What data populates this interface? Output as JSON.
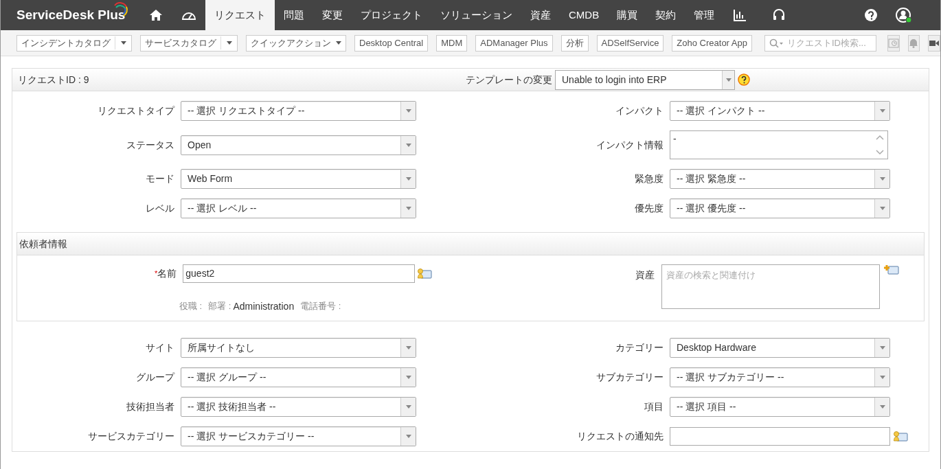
{
  "nav": {
    "logo": "ServiceDesk Plus",
    "tabs": [
      {
        "label": "リクエスト",
        "selected": true
      },
      {
        "label": "問題",
        "selected": false
      },
      {
        "label": "変更",
        "selected": false
      },
      {
        "label": "プロジェクト",
        "selected": false
      },
      {
        "label": "ソリューション",
        "selected": false
      },
      {
        "label": "資産",
        "selected": false
      },
      {
        "label": "CMDB",
        "selected": false
      },
      {
        "label": "購買",
        "selected": false
      },
      {
        "label": "契約",
        "selected": false
      },
      {
        "label": "管理",
        "selected": false
      }
    ]
  },
  "toolbar": {
    "buttons": [
      {
        "kind": "split",
        "label": "インシデントカタログ"
      },
      {
        "kind": "split",
        "label": "サービスカタログ"
      },
      {
        "kind": "dropdown",
        "label": "クイックアクション"
      },
      {
        "kind": "plain",
        "label": "Desktop Central"
      },
      {
        "kind": "plain",
        "label": "MDM"
      },
      {
        "kind": "plain",
        "label": "ADManager Plus"
      },
      {
        "kind": "plain",
        "label": "分析"
      },
      {
        "kind": "plain",
        "label": "ADSelfService"
      },
      {
        "kind": "plain",
        "label": "Zoho Creator App"
      }
    ],
    "search": {
      "placeholder": "リクエストID検索..."
    }
  },
  "form": {
    "request_id": "リクエストID : 9",
    "template_label": "テンプレートの変更",
    "template_value": "Unable to login into ERP",
    "rows": [
      {
        "left": {
          "label": "リクエストタイプ",
          "kind": "select",
          "value": "-- 選択 リクエストタイプ --"
        },
        "right": {
          "label": "インパクト",
          "kind": "select",
          "value": "-- 選択 インパクト --"
        }
      },
      {
        "left": {
          "label": "ステータス",
          "kind": "select",
          "value": "Open"
        },
        "right": {
          "label": "インパクト情報",
          "kind": "textarea",
          "value": "-"
        }
      },
      {
        "left": {
          "label": "モード",
          "kind": "select",
          "value": "Web Form"
        },
        "right": {
          "label": "緊急度",
          "kind": "select",
          "value": "-- 選択 緊急度 --"
        }
      },
      {
        "left": {
          "label": "レベル",
          "kind": "select",
          "value": "-- 選択 レベル --"
        },
        "right": {
          "label": "優先度",
          "kind": "select",
          "value": "-- 選択 優先度 --"
        }
      }
    ],
    "requester": {
      "title": "依頼者情報",
      "name_label": "名前",
      "required_mark": "*",
      "name_value": "guest2",
      "details": [
        "役職 :",
        "部署 :",
        "Administration",
        "電話番号 :"
      ],
      "asset_label": "資産",
      "asset_placeholder": "資産の検索と関連付け"
    },
    "rows2": [
      {
        "left": {
          "label": "サイト",
          "kind": "select",
          "value": "所属サイトなし"
        },
        "right": {
          "label": "カテゴリー",
          "kind": "select",
          "value": "Desktop Hardware"
        }
      },
      {
        "left": {
          "label": "グループ",
          "kind": "select",
          "value": "-- 選択 グループ --"
        },
        "right": {
          "label": "サブカテゴリー",
          "kind": "select",
          "value": "-- 選択 サブカテゴリー --"
        }
      },
      {
        "left": {
          "label": "技術担当者",
          "kind": "select",
          "value": "-- 選択 技術担当者 --"
        },
        "right": {
          "label": "項目",
          "kind": "select",
          "value": "-- 選択 項目 --"
        }
      },
      {
        "left": {
          "label": "サービスカテゴリー",
          "kind": "select",
          "value": "-- 選択 サービスカテゴリー --"
        },
        "right": {
          "label": "リクエストの通知先",
          "kind": "input"
        }
      }
    ]
  }
}
